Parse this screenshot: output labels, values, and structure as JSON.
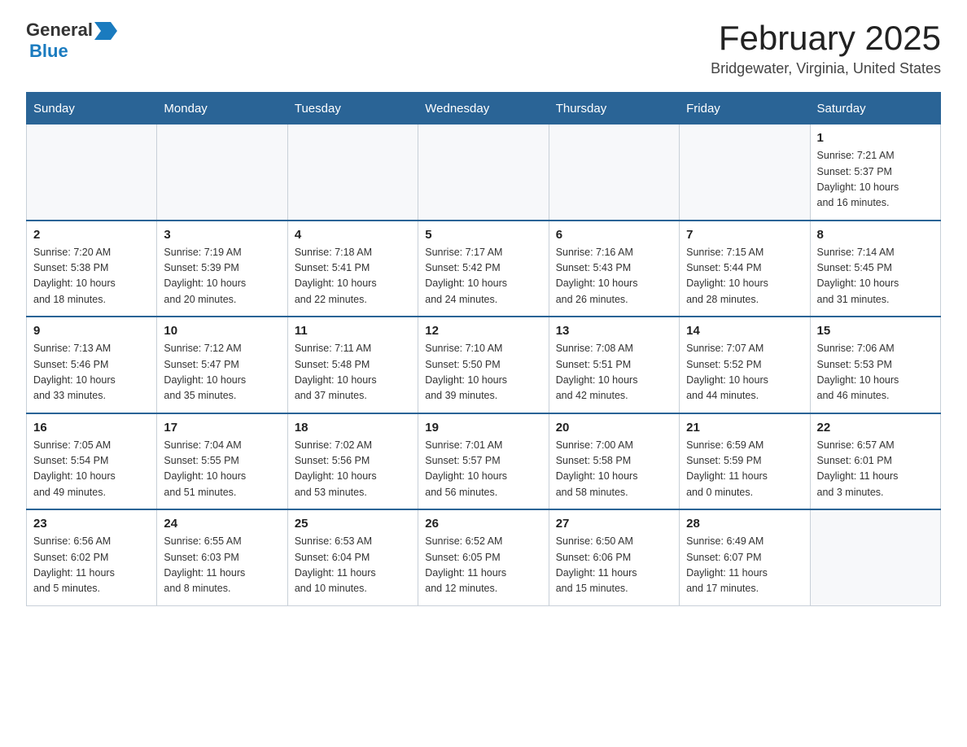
{
  "header": {
    "logo": {
      "line1_general": "General",
      "line2_blue": "Blue",
      "arrow_color": "#1a7bbf"
    },
    "title": "February 2025",
    "location": "Bridgewater, Virginia, United States"
  },
  "days_of_week": [
    "Sunday",
    "Monday",
    "Tuesday",
    "Wednesday",
    "Thursday",
    "Friday",
    "Saturday"
  ],
  "weeks": [
    [
      {
        "day": "",
        "info": ""
      },
      {
        "day": "",
        "info": ""
      },
      {
        "day": "",
        "info": ""
      },
      {
        "day": "",
        "info": ""
      },
      {
        "day": "",
        "info": ""
      },
      {
        "day": "",
        "info": ""
      },
      {
        "day": "1",
        "info": "Sunrise: 7:21 AM\nSunset: 5:37 PM\nDaylight: 10 hours\nand 16 minutes."
      }
    ],
    [
      {
        "day": "2",
        "info": "Sunrise: 7:20 AM\nSunset: 5:38 PM\nDaylight: 10 hours\nand 18 minutes."
      },
      {
        "day": "3",
        "info": "Sunrise: 7:19 AM\nSunset: 5:39 PM\nDaylight: 10 hours\nand 20 minutes."
      },
      {
        "day": "4",
        "info": "Sunrise: 7:18 AM\nSunset: 5:41 PM\nDaylight: 10 hours\nand 22 minutes."
      },
      {
        "day": "5",
        "info": "Sunrise: 7:17 AM\nSunset: 5:42 PM\nDaylight: 10 hours\nand 24 minutes."
      },
      {
        "day": "6",
        "info": "Sunrise: 7:16 AM\nSunset: 5:43 PM\nDaylight: 10 hours\nand 26 minutes."
      },
      {
        "day": "7",
        "info": "Sunrise: 7:15 AM\nSunset: 5:44 PM\nDaylight: 10 hours\nand 28 minutes."
      },
      {
        "day": "8",
        "info": "Sunrise: 7:14 AM\nSunset: 5:45 PM\nDaylight: 10 hours\nand 31 minutes."
      }
    ],
    [
      {
        "day": "9",
        "info": "Sunrise: 7:13 AM\nSunset: 5:46 PM\nDaylight: 10 hours\nand 33 minutes."
      },
      {
        "day": "10",
        "info": "Sunrise: 7:12 AM\nSunset: 5:47 PM\nDaylight: 10 hours\nand 35 minutes."
      },
      {
        "day": "11",
        "info": "Sunrise: 7:11 AM\nSunset: 5:48 PM\nDaylight: 10 hours\nand 37 minutes."
      },
      {
        "day": "12",
        "info": "Sunrise: 7:10 AM\nSunset: 5:50 PM\nDaylight: 10 hours\nand 39 minutes."
      },
      {
        "day": "13",
        "info": "Sunrise: 7:08 AM\nSunset: 5:51 PM\nDaylight: 10 hours\nand 42 minutes."
      },
      {
        "day": "14",
        "info": "Sunrise: 7:07 AM\nSunset: 5:52 PM\nDaylight: 10 hours\nand 44 minutes."
      },
      {
        "day": "15",
        "info": "Sunrise: 7:06 AM\nSunset: 5:53 PM\nDaylight: 10 hours\nand 46 minutes."
      }
    ],
    [
      {
        "day": "16",
        "info": "Sunrise: 7:05 AM\nSunset: 5:54 PM\nDaylight: 10 hours\nand 49 minutes."
      },
      {
        "day": "17",
        "info": "Sunrise: 7:04 AM\nSunset: 5:55 PM\nDaylight: 10 hours\nand 51 minutes."
      },
      {
        "day": "18",
        "info": "Sunrise: 7:02 AM\nSunset: 5:56 PM\nDaylight: 10 hours\nand 53 minutes."
      },
      {
        "day": "19",
        "info": "Sunrise: 7:01 AM\nSunset: 5:57 PM\nDaylight: 10 hours\nand 56 minutes."
      },
      {
        "day": "20",
        "info": "Sunrise: 7:00 AM\nSunset: 5:58 PM\nDaylight: 10 hours\nand 58 minutes."
      },
      {
        "day": "21",
        "info": "Sunrise: 6:59 AM\nSunset: 5:59 PM\nDaylight: 11 hours\nand 0 minutes."
      },
      {
        "day": "22",
        "info": "Sunrise: 6:57 AM\nSunset: 6:01 PM\nDaylight: 11 hours\nand 3 minutes."
      }
    ],
    [
      {
        "day": "23",
        "info": "Sunrise: 6:56 AM\nSunset: 6:02 PM\nDaylight: 11 hours\nand 5 minutes."
      },
      {
        "day": "24",
        "info": "Sunrise: 6:55 AM\nSunset: 6:03 PM\nDaylight: 11 hours\nand 8 minutes."
      },
      {
        "day": "25",
        "info": "Sunrise: 6:53 AM\nSunset: 6:04 PM\nDaylight: 11 hours\nand 10 minutes."
      },
      {
        "day": "26",
        "info": "Sunrise: 6:52 AM\nSunset: 6:05 PM\nDaylight: 11 hours\nand 12 minutes."
      },
      {
        "day": "27",
        "info": "Sunrise: 6:50 AM\nSunset: 6:06 PM\nDaylight: 11 hours\nand 15 minutes."
      },
      {
        "day": "28",
        "info": "Sunrise: 6:49 AM\nSunset: 6:07 PM\nDaylight: 11 hours\nand 17 minutes."
      },
      {
        "day": "",
        "info": ""
      }
    ]
  ]
}
